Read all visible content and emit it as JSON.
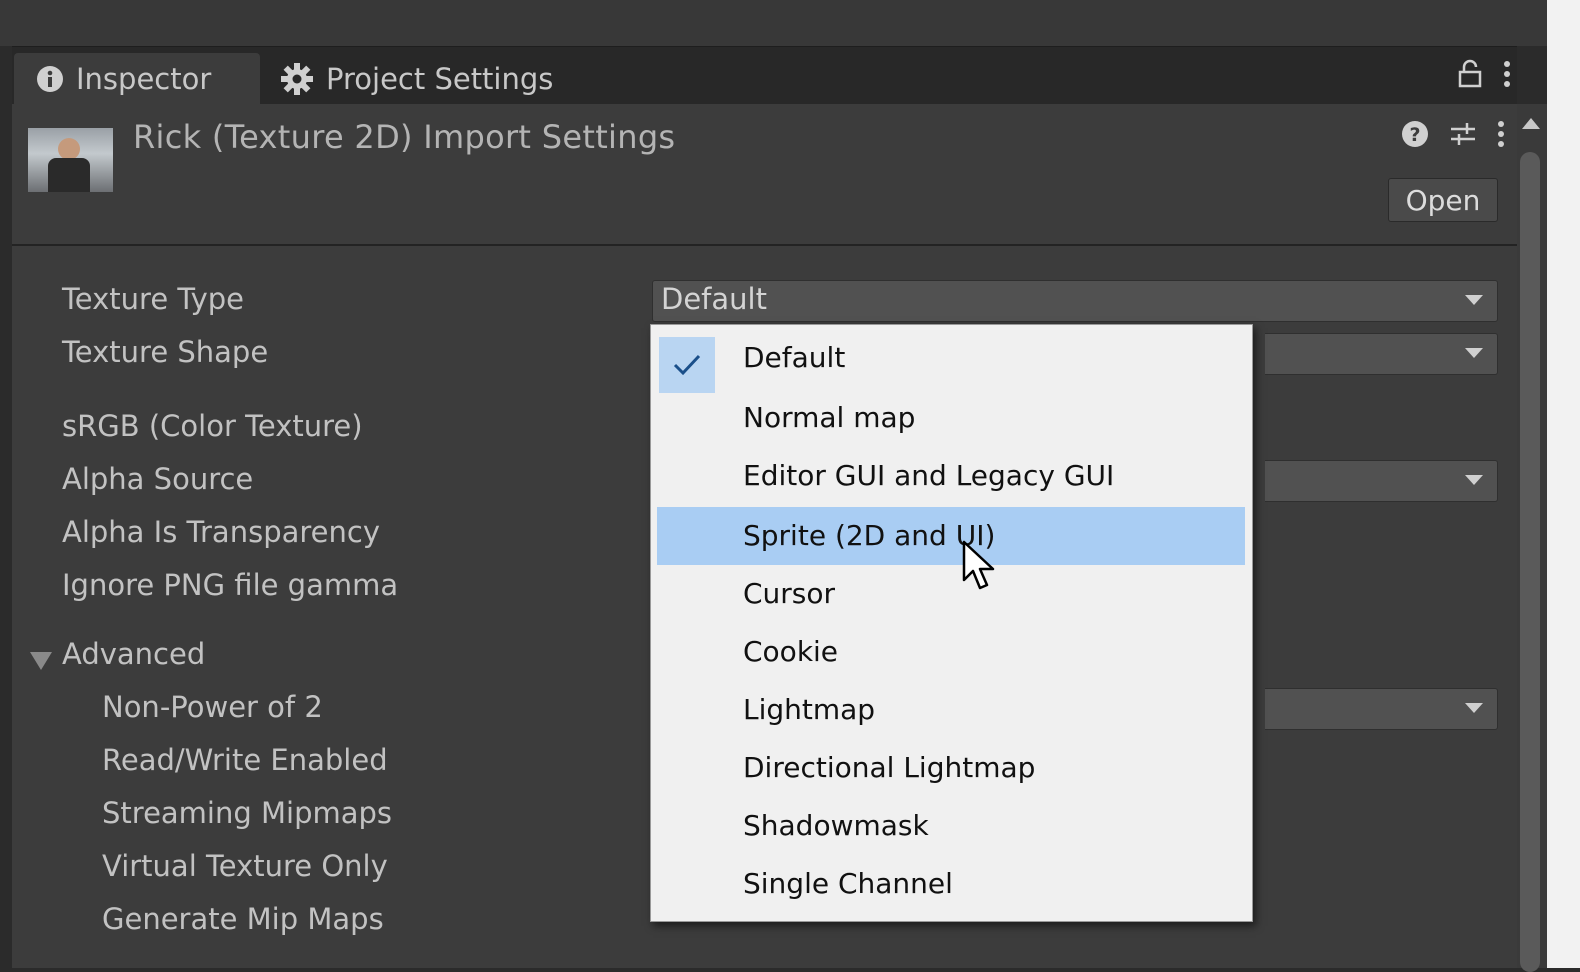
{
  "tabs": {
    "inspector": "Inspector",
    "project_settings": "Project Settings"
  },
  "header": {
    "title": "Rick (Texture 2D) Import Settings",
    "open_button": "Open"
  },
  "fields": {
    "texture_type": {
      "label": "Texture Type",
      "value": "Default"
    },
    "texture_shape": {
      "label": "Texture Shape"
    },
    "srgb": {
      "label": "sRGB (Color Texture)"
    },
    "alpha_source": {
      "label": "Alpha Source"
    },
    "alpha_is_transparency": {
      "label": "Alpha Is Transparency"
    },
    "ignore_png_gamma": {
      "label": "Ignore PNG file gamma"
    },
    "advanced": {
      "label": "Advanced"
    },
    "non_power_of_2": {
      "label": "Non-Power of 2"
    },
    "read_write": {
      "label": "Read/Write Enabled"
    },
    "streaming_mipmaps": {
      "label": "Streaming Mipmaps"
    },
    "virtual_texture_only": {
      "label": "Virtual Texture Only"
    },
    "generate_mip_maps": {
      "label": "Generate Mip Maps"
    }
  },
  "dropdown_menu": {
    "items": [
      "Default",
      "Normal map",
      "Editor GUI and Legacy GUI",
      "Sprite (2D and UI)",
      "Cursor",
      "Cookie",
      "Lightmap",
      "Directional Lightmap",
      "Shadowmask",
      "Single Channel"
    ],
    "checked": "Default",
    "hovered": "Sprite (2D and UI)"
  },
  "colors": {
    "panel_bg": "#3c3c3c",
    "menu_bg": "#f0f0f0",
    "menu_hover": "#a9cdf3"
  }
}
